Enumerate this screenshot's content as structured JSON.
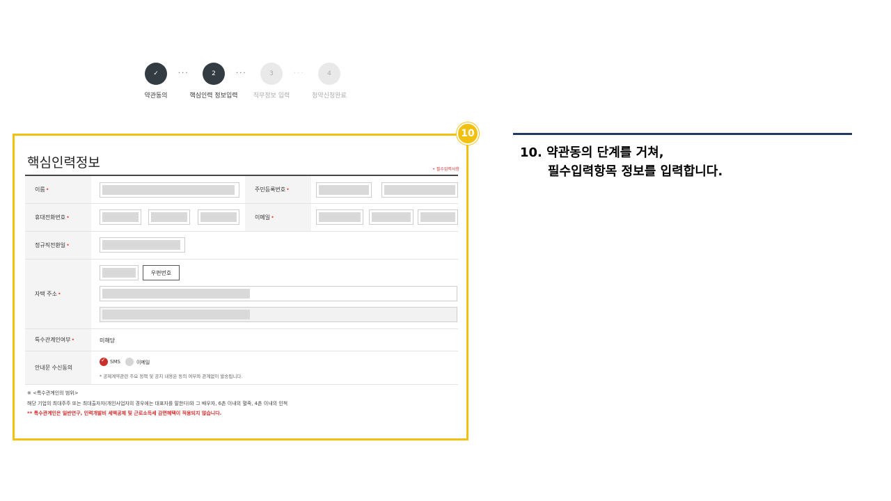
{
  "steps": [
    {
      "number": "✓",
      "label": "약관동의",
      "state": "done"
    },
    {
      "number": "2",
      "label": "핵심인력 정보입력",
      "state": "active"
    },
    {
      "number": "3",
      "label": "직무정보 입력",
      "state": "todo"
    },
    {
      "number": "4",
      "label": "청약신청완료",
      "state": "todo"
    }
  ],
  "badge": "10",
  "form": {
    "title": "핵심인력정보",
    "required_note": "• 필수입력사항",
    "labels": {
      "name": "이름",
      "resident_number": "주민등록번호",
      "mobile": "휴대전화번호",
      "email": "이메일",
      "hire_date": "정규직전환일",
      "address": "자택 주소",
      "special_relation": "특수관계인여부",
      "consent": "안내문 수신동의"
    },
    "required_mark": "•",
    "postcode_button": "우편번호",
    "special_relation_value": "미해당",
    "consent_options": [
      {
        "label": "SMS",
        "selected": true
      },
      {
        "label": "이메일",
        "selected": false
      }
    ],
    "consent_note": "* 공제계약관련 주요 정책 및 공지 내용은 동의 여부와 관계없이 발송됩니다.",
    "notes": {
      "heading": "※ <특수관계인의 범위>",
      "body": "해당 기업의 최대주주 또는 최대출자자(개인사업자의 경우에는 대표자를 말한다)와 그 배우자, 6촌 이내의 혈족, 4촌 이내의 인척",
      "warning": "** 특수관계인은 일반연구, 인력개발비 세액공제 및 근로소득세 감면혜택이 적용되지 않습니다."
    }
  },
  "instruction": {
    "line1": "10. 약관동의 단계를 거쳐,",
    "line2": "필수입력항목 정보를 입력합니다."
  },
  "colors": {
    "accent": "#f2c10f",
    "navy": "#1f3864",
    "required": "#e43b2c",
    "step_dark": "#333c42"
  }
}
